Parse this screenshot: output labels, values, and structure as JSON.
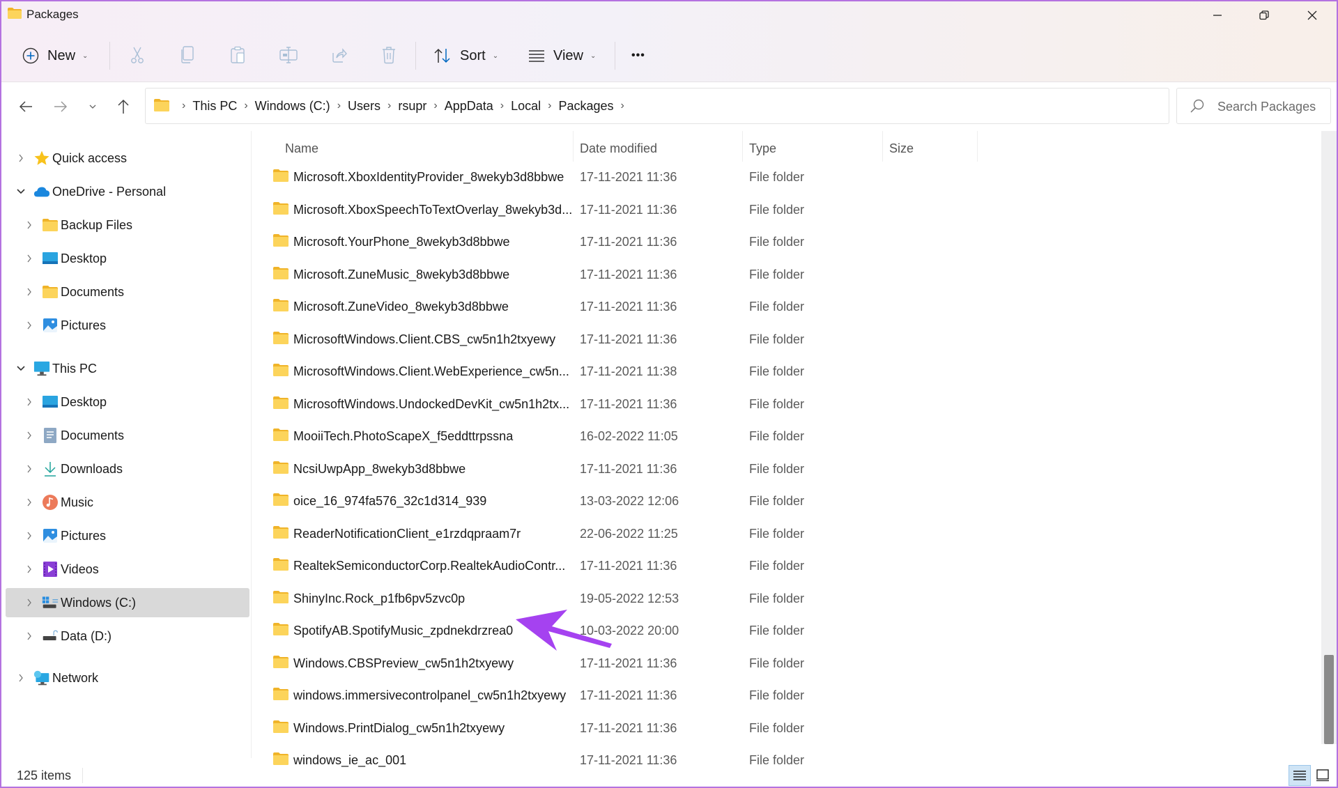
{
  "window": {
    "title": "Packages",
    "controls": {
      "minimize": "Minimize",
      "maximize": "Restore",
      "close": "Close"
    }
  },
  "toolbar": {
    "new_label": "New",
    "sort_label": "Sort",
    "view_label": "View",
    "more_label": "•••",
    "icons": [
      "cut-icon",
      "copy-icon",
      "paste-icon",
      "rename-icon",
      "share-icon",
      "delete-icon"
    ]
  },
  "navigation": {
    "back": "Back",
    "forward": "Forward",
    "recent": "Recent locations",
    "up": "Up"
  },
  "address": {
    "crumbs": [
      "This PC",
      "Windows (C:)",
      "Users",
      "rsupr",
      "AppData",
      "Local",
      "Packages"
    ]
  },
  "search": {
    "placeholder": "Search Packages",
    "value": ""
  },
  "sidebar": {
    "items": [
      {
        "label": "Quick access",
        "icon": "star-icon",
        "level": 0,
        "expanded": false
      },
      {
        "label": "OneDrive - Personal",
        "icon": "cloud-icon",
        "level": 0,
        "expanded": true
      },
      {
        "label": "Backup Files",
        "icon": "folder-icon",
        "level": 1,
        "expanded": false
      },
      {
        "label": "Desktop",
        "icon": "desktop-icon",
        "level": 1,
        "expanded": false
      },
      {
        "label": "Documents",
        "icon": "folder-icon",
        "level": 1,
        "expanded": false
      },
      {
        "label": "Pictures",
        "icon": "pictures-icon",
        "level": 1,
        "expanded": false
      },
      {
        "label": "This PC",
        "icon": "computer-icon",
        "level": 0,
        "expanded": true
      },
      {
        "label": "Desktop",
        "icon": "desktop-icon",
        "level": 1,
        "expanded": false
      },
      {
        "label": "Documents",
        "icon": "documents-icon",
        "level": 1,
        "expanded": false
      },
      {
        "label": "Downloads",
        "icon": "download-icon",
        "level": 1,
        "expanded": false
      },
      {
        "label": "Music",
        "icon": "music-icon",
        "level": 1,
        "expanded": false
      },
      {
        "label": "Pictures",
        "icon": "pictures-icon",
        "level": 1,
        "expanded": false
      },
      {
        "label": "Videos",
        "icon": "videos-icon",
        "level": 1,
        "expanded": false
      },
      {
        "label": "Windows (C:)",
        "icon": "windows-drive-icon",
        "level": 1,
        "expanded": false,
        "selected": true
      },
      {
        "label": "Data (D:)",
        "icon": "drive-icon",
        "level": 1,
        "expanded": false
      },
      {
        "label": "Network",
        "icon": "network-icon",
        "level": 0,
        "expanded": false
      }
    ]
  },
  "list": {
    "columns": [
      "Name",
      "Date modified",
      "Type",
      "Size"
    ],
    "sorted_column": "Size",
    "rows": [
      {
        "name": "Microsoft.XboxIdentityProvider_8wekyb3d8bbwe",
        "date": "17-11-2021 11:36",
        "type": "File folder",
        "size": ""
      },
      {
        "name": "Microsoft.XboxSpeechToTextOverlay_8wekyb3d...",
        "date": "17-11-2021 11:36",
        "type": "File folder",
        "size": ""
      },
      {
        "name": "Microsoft.YourPhone_8wekyb3d8bbwe",
        "date": "17-11-2021 11:36",
        "type": "File folder",
        "size": ""
      },
      {
        "name": "Microsoft.ZuneMusic_8wekyb3d8bbwe",
        "date": "17-11-2021 11:36",
        "type": "File folder",
        "size": ""
      },
      {
        "name": "Microsoft.ZuneVideo_8wekyb3d8bbwe",
        "date": "17-11-2021 11:36",
        "type": "File folder",
        "size": ""
      },
      {
        "name": "MicrosoftWindows.Client.CBS_cw5n1h2txyewy",
        "date": "17-11-2021 11:36",
        "type": "File folder",
        "size": ""
      },
      {
        "name": "MicrosoftWindows.Client.WebExperience_cw5n...",
        "date": "17-11-2021 11:38",
        "type": "File folder",
        "size": ""
      },
      {
        "name": "MicrosoftWindows.UndockedDevKit_cw5n1h2tx...",
        "date": "17-11-2021 11:36",
        "type": "File folder",
        "size": ""
      },
      {
        "name": "MooiiTech.PhotoScapeX_f5eddttrpssna",
        "date": "16-02-2022 11:05",
        "type": "File folder",
        "size": ""
      },
      {
        "name": "NcsiUwpApp_8wekyb3d8bbwe",
        "date": "17-11-2021 11:36",
        "type": "File folder",
        "size": ""
      },
      {
        "name": "oice_16_974fa576_32c1d314_939",
        "date": "13-03-2022 12:06",
        "type": "File folder",
        "size": ""
      },
      {
        "name": "ReaderNotificationClient_e1rzdqpraam7r",
        "date": "22-06-2022 11:25",
        "type": "File folder",
        "size": ""
      },
      {
        "name": "RealtekSemiconductorCorp.RealtekAudioContr...",
        "date": "17-11-2021 11:36",
        "type": "File folder",
        "size": ""
      },
      {
        "name": "ShinyInc.Rock_p1fb6pv5zvc0p",
        "date": "19-05-2022 12:53",
        "type": "File folder",
        "size": ""
      },
      {
        "name": "SpotifyAB.SpotifyMusic_zpdnekdrzrea0",
        "date": "10-03-2022 20:00",
        "type": "File folder",
        "size": "",
        "highlighted_by_arrow": true
      },
      {
        "name": "Windows.CBSPreview_cw5n1h2txyewy",
        "date": "17-11-2021 11:36",
        "type": "File folder",
        "size": ""
      },
      {
        "name": "windows.immersivecontrolpanel_cw5n1h2txyewy",
        "date": "17-11-2021 11:36",
        "type": "File folder",
        "size": ""
      },
      {
        "name": "Windows.PrintDialog_cw5n1h2txyewy",
        "date": "17-11-2021 11:36",
        "type": "File folder",
        "size": ""
      },
      {
        "name": "windows_ie_ac_001",
        "date": "17-11-2021 11:36",
        "type": "File folder",
        "size": ""
      }
    ]
  },
  "scroll": {
    "thumb_start_fraction": 0.855,
    "thumb_size_fraction": 0.145
  },
  "status": {
    "item_count": "125 items",
    "view_modes": [
      "Details",
      "Large icons"
    ],
    "active_view": "Details"
  },
  "colors": {
    "accent": "#0067c0",
    "annotation_arrow": "#a542f0",
    "window_border": "#b472e0",
    "folder": "#f7c948",
    "selected_nav": "#d9d9d9"
  }
}
